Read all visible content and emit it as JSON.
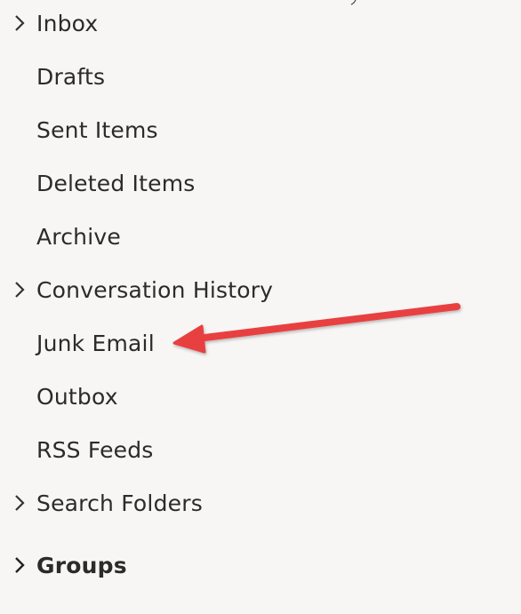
{
  "folders": [
    {
      "label": "Inbox",
      "expandable": true,
      "bold": false
    },
    {
      "label": "Drafts",
      "expandable": false,
      "bold": false
    },
    {
      "label": "Sent Items",
      "expandable": false,
      "bold": false
    },
    {
      "label": "Deleted Items",
      "expandable": false,
      "bold": false
    },
    {
      "label": "Archive",
      "expandable": false,
      "bold": false
    },
    {
      "label": "Conversation History",
      "expandable": true,
      "bold": false
    },
    {
      "label": "Junk Email",
      "expandable": false,
      "bold": false
    },
    {
      "label": "Outbox",
      "expandable": false,
      "bold": false
    },
    {
      "label": "RSS Feeds",
      "expandable": false,
      "bold": false
    },
    {
      "label": "Search Folders",
      "expandable": true,
      "bold": false
    }
  ],
  "groups": {
    "label": "Groups",
    "expandable": true,
    "bold": true
  },
  "icons": {
    "chevron": "chevron-right-icon"
  },
  "annotation": {
    "color": "#e8403f",
    "target": "Junk Email"
  }
}
